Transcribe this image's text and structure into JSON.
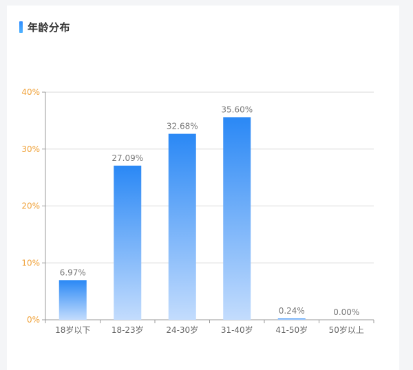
{
  "header": {
    "title": "年龄分布"
  },
  "colors": {
    "bar_top": "#2a88f5",
    "bar_bottom": "#c3dcfd",
    "ytick": "#f0a23a",
    "grid": "#d8d8d8",
    "axis": "#999999"
  },
  "chart_data": {
    "type": "bar",
    "title": "年龄分布",
    "categories": [
      "18岁以下",
      "18-23岁",
      "24-30岁",
      "31-40岁",
      "41-50岁",
      "50岁以上"
    ],
    "values": [
      6.97,
      27.09,
      32.68,
      35.6,
      0.24,
      0.0
    ],
    "data_labels": [
      "6.97%",
      "27.09%",
      "32.68%",
      "35.60%",
      "0.24%",
      "0.00%"
    ],
    "y_tick_labels": [
      "0%",
      "10%",
      "20%",
      "30%",
      "40%"
    ],
    "y_ticks": [
      0,
      10,
      20,
      30,
      40
    ],
    "ylim": [
      0,
      40
    ],
    "grid": true,
    "legend": "none"
  }
}
